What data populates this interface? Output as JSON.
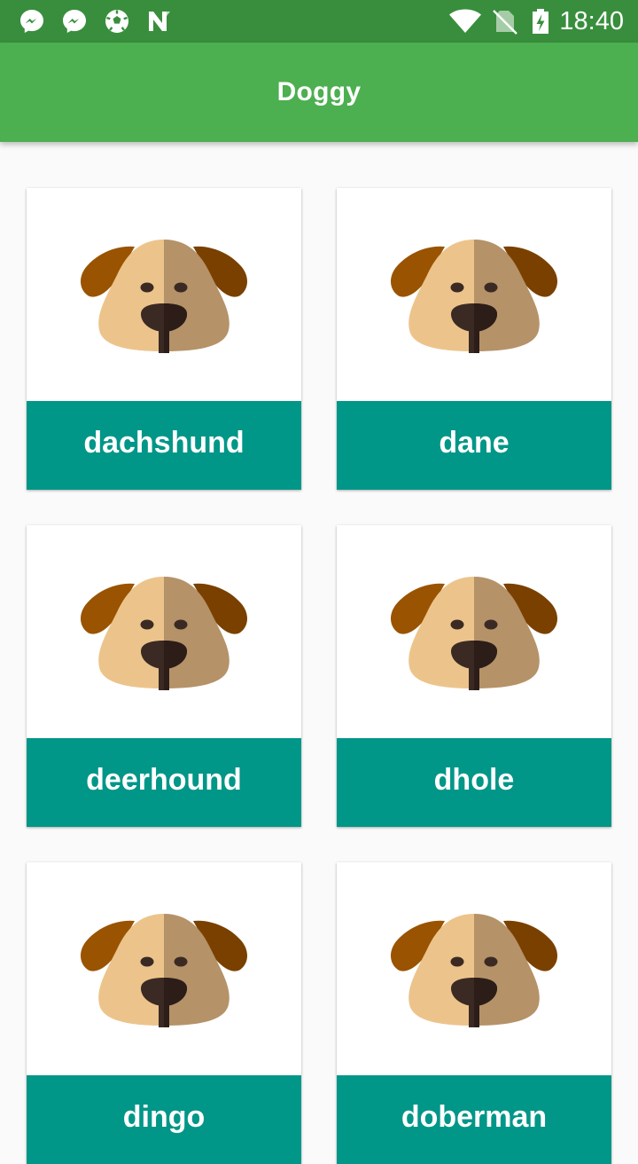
{
  "status_bar": {
    "time": "18:40",
    "left_icons": [
      "messenger-icon",
      "messenger-icon",
      "soccer-ball-icon",
      "n-logo-icon"
    ],
    "right_icons": [
      "wifi-icon",
      "no-sim-icon",
      "battery-charging-icon"
    ]
  },
  "app_bar": {
    "title": "Doggy",
    "color": "#4caf50"
  },
  "accent_color": "#009688",
  "breeds": [
    {
      "name": "dachshund",
      "icon": "dog-face-icon"
    },
    {
      "name": "dane",
      "icon": "dog-face-icon"
    },
    {
      "name": "deerhound",
      "icon": "dog-face-icon"
    },
    {
      "name": "dhole",
      "icon": "dog-face-icon"
    },
    {
      "name": "dingo",
      "icon": "dog-face-icon"
    },
    {
      "name": "doberman",
      "icon": "dog-face-icon"
    }
  ]
}
